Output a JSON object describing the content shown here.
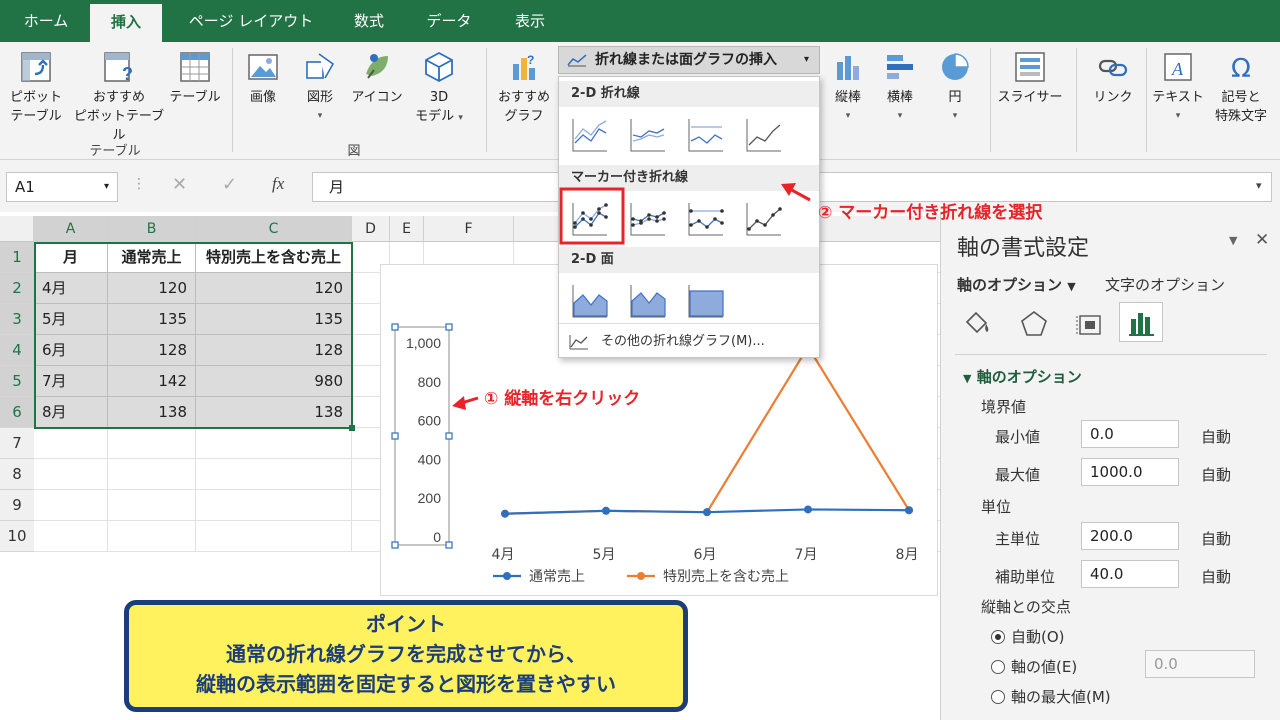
{
  "tabs": [
    "ホーム",
    "挿入",
    "ページ レイアウト",
    "数式",
    "データ",
    "表示"
  ],
  "ribbon": {
    "pivot": "ピボット\nテーブル",
    "pivot_l1": "ピボット",
    "pivot_l2": "テーブル",
    "rec_pivot_l1": "おすすめ",
    "rec_pivot_l2": "ピボットテーブル",
    "table": "テーブル",
    "group_table": "テーブル",
    "image": "画像",
    "shapes": "図形",
    "icons": "アイコン",
    "model3d_l1": "3D",
    "model3d_l2": "モデル",
    "group_zu": "図",
    "rec_chart_l1": "おすすめ",
    "rec_chart_l2": "グラフ",
    "vertical": "縦棒",
    "horizontal": "横棒",
    "pie": "円",
    "slicer": "スライサー",
    "link": "リンク",
    "text": "テキスト",
    "symbol_l1": "記号と",
    "symbol_l2": "特殊文字"
  },
  "formula_bar": {
    "namebox": "A1",
    "fx": "fx",
    "content": "月"
  },
  "grid": {
    "columns": [
      "A",
      "B",
      "C",
      "D",
      "E",
      "F"
    ],
    "rows": [
      "1",
      "2",
      "3",
      "4",
      "5",
      "6",
      "7",
      "8",
      "9",
      "10"
    ],
    "header": [
      "月",
      "通常売上",
      "特別売上を含む売上"
    ],
    "data": [
      [
        "4月",
        "120",
        "120"
      ],
      [
        "5月",
        "135",
        "135"
      ],
      [
        "6月",
        "128",
        "128"
      ],
      [
        "7月",
        "142",
        "980"
      ],
      [
        "8月",
        "138",
        "138"
      ]
    ]
  },
  "dropdown": {
    "title": "折れ線または面グラフの挿入",
    "sec_2d_line": "2-D 折れ線",
    "sec_marker": "マーカー付き折れ線",
    "sec_2d_area": "2-D 面",
    "more": "その他の折れ線グラフ(M)..."
  },
  "pane": {
    "title": "軸の書式設定",
    "tab_axis": "軸のオプション",
    "tab_text": "文字のオプション",
    "section": "軸のオプション",
    "bounds": "境界値",
    "min_label": "最小値",
    "min_value": "0.0",
    "max_label": "最大値",
    "max_value": "1000.0",
    "auto": "自動",
    "units": "単位",
    "major_label": "主単位",
    "major_value": "200.0",
    "minor_label": "補助単位",
    "minor_value": "40.0",
    "cross": "縦軸との交点",
    "opt_auto": "自動(O)",
    "opt_value": "軸の値(E)",
    "opt_value_input": "0.0",
    "opt_max": "軸の最大値(M)"
  },
  "annotations": {
    "step1": "① 縦軸を右クリック",
    "step2": "② マーカー付き折れ線を選択",
    "callout_l1": "ポイント",
    "callout_l2": "通常の折れ線グラフを完成させてから、",
    "callout_l3": "縦軸の表示範囲を固定すると図形を置きやすい"
  },
  "chart_data": {
    "type": "line",
    "categories": [
      "4月",
      "5月",
      "6月",
      "7月",
      "8月"
    ],
    "series": [
      {
        "name": "通常売上",
        "values": [
          120,
          135,
          128,
          142,
          138
        ],
        "color": "#2e6fbf"
      },
      {
        "name": "特別売上を含む売上",
        "values": [
          120,
          135,
          128,
          980,
          138
        ],
        "color": "#ed7d31"
      }
    ],
    "yticks": [
      "1,000",
      "800",
      "600",
      "400",
      "200",
      "0"
    ],
    "ylim": [
      0,
      1000
    ],
    "legend": "bottom"
  },
  "colors": {
    "excel_green": "#217346",
    "annotation_red": "#e8242a",
    "callout_yellow": "#fff25e",
    "callout_border": "#1b3e7a"
  }
}
